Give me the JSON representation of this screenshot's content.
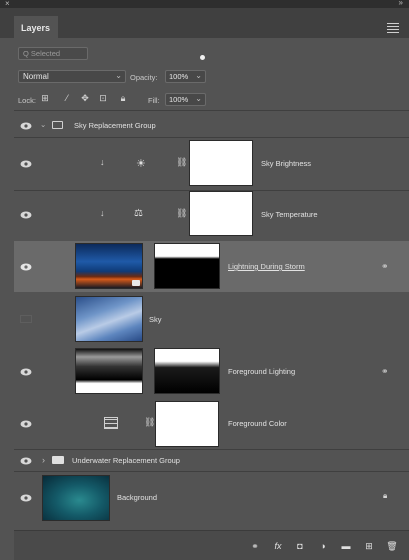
{
  "panel": {
    "close_glyph": "×",
    "collapse_glyph": "»",
    "tab_label": "Layers",
    "filter_placeholder": "Q Selected",
    "blend_mode": "Normal",
    "opacity_label": "Opacity:",
    "opacity_value": "100%",
    "lock_label": "Lock:",
    "fill_label": "Fill:",
    "fill_value": "100%"
  },
  "layers": [
    {
      "name": "Sky Replacement Group",
      "kind": "group",
      "expanded": true
    },
    {
      "name": "Sky Brightness",
      "kind": "adjustment",
      "icon": "brightness-icon"
    },
    {
      "name": "Sky Temperature",
      "kind": "adjustment",
      "icon": "color-balance-icon"
    },
    {
      "name": "Lightning During Storm",
      "kind": "image-with-mask",
      "selected": true
    },
    {
      "name": "Sky",
      "kind": "image",
      "visible": false
    },
    {
      "name": "Foreground Lighting",
      "kind": "image-with-mask"
    },
    {
      "name": "Foreground Color",
      "kind": "adjustment",
      "icon": "grid-icon"
    },
    {
      "name": "Underwater Replacement Group",
      "kind": "group",
      "expanded": false
    },
    {
      "name": "Background",
      "kind": "image",
      "locked": true
    }
  ],
  "bottom_icons": [
    "link-icon",
    "fx-icon",
    "mask-icon",
    "adjustment-icon",
    "folder-icon",
    "new-layer-icon",
    "trash-icon"
  ],
  "colors": {
    "panel": "#535353",
    "selected_row": "#6a6a6a",
    "tabbar": "#404040"
  }
}
